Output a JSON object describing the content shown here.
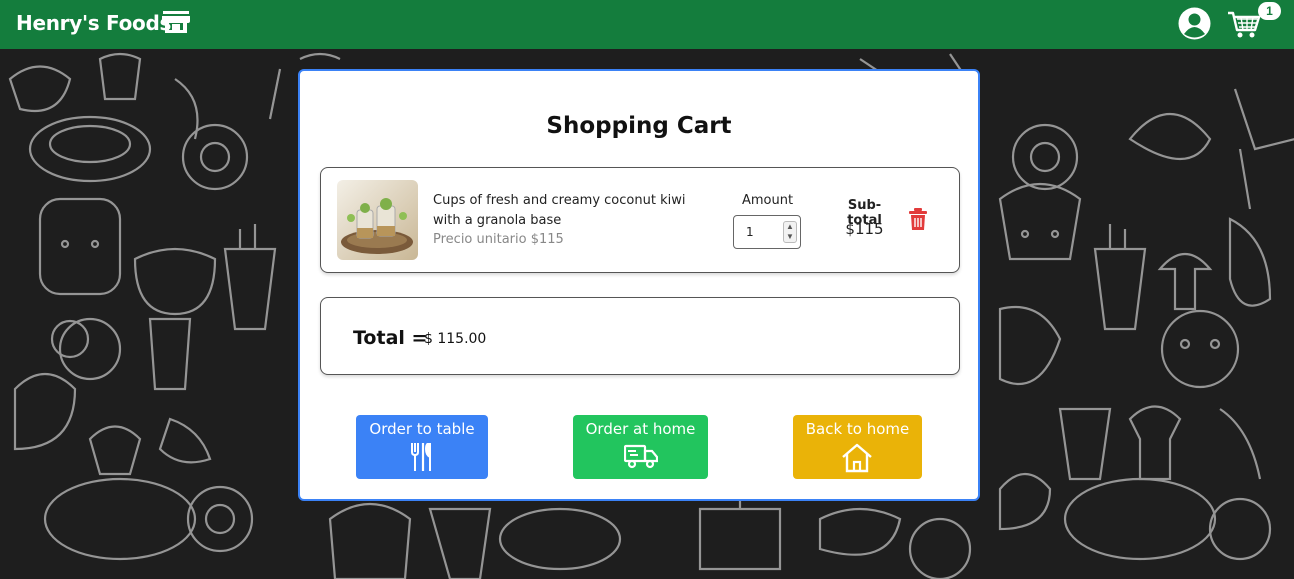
{
  "header": {
    "brand": "Henry's Foods",
    "brand_icon": "store-icon",
    "user_icon": "user-circle-icon",
    "cart_icon": "cart-icon",
    "cart_count": "1",
    "background_color": "#147d3d"
  },
  "cart": {
    "title": "Shopping Cart",
    "items": [
      {
        "name": "Cups of fresh and creamy coconut kiwi with a granola base",
        "unit_price": "Precio unitario $115",
        "amount_label": "Amount",
        "amount": "1",
        "subtotal_label": "Sub-total",
        "subtotal": "$115"
      }
    ],
    "total_label": "Total =",
    "total_value": "$ 115.00"
  },
  "actions": {
    "order_table": "Order to table",
    "order_home": "Order at home",
    "back_home": "Back to home"
  },
  "colors": {
    "accent_blue": "#3b82f6",
    "green": "#22c55e",
    "yellow": "#eab308",
    "delete_red": "#e23b3b"
  }
}
